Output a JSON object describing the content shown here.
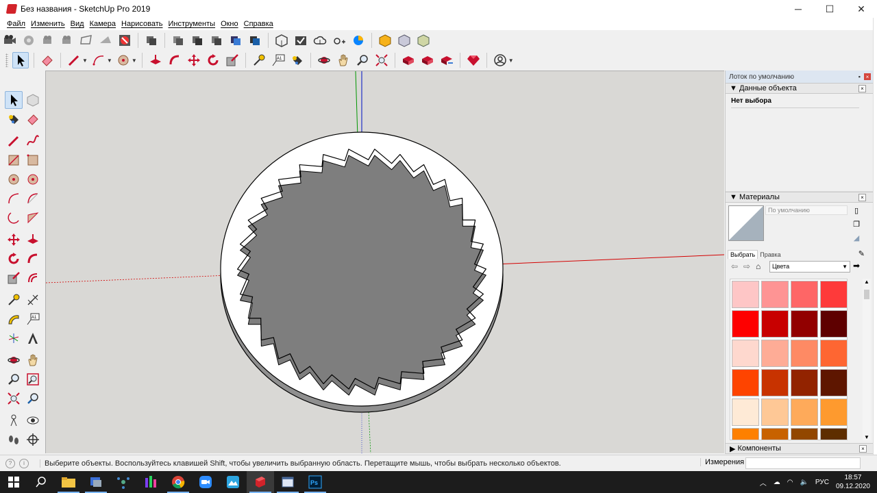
{
  "window": {
    "title": "Без названия - SketchUp Pro 2019"
  },
  "menu": [
    "Файл",
    "Изменить",
    "Вид",
    "Камера",
    "Нарисовать",
    "Инструменты",
    "Окно",
    "Справка"
  ],
  "tray": {
    "title": "Лоток по умолчанию",
    "entity_info": {
      "header": "Данные объекта",
      "status": "Нет выбора"
    },
    "materials": {
      "header": "Материалы",
      "name": "По умолчанию",
      "tab_select": "Выбрать",
      "tab_edit": "Правка",
      "category": "Цвета",
      "swatches": [
        "#fec6c6",
        "#fe9494",
        "#fe6666",
        "#fe3a3a",
        "#fe0000",
        "#c80000",
        "#920000",
        "#5e0000",
        "#fed8ce",
        "#feac96",
        "#fe8a64",
        "#fe6632",
        "#fe4400",
        "#c83300",
        "#922300",
        "#5e1600",
        "#feead6",
        "#fec896",
        "#feaa5a",
        "#fe9a2e",
        "#fe8000",
        "#c86200",
        "#924700",
        "#5e2e00"
      ]
    },
    "components": {
      "header": "Компоненты"
    }
  },
  "status": {
    "hint": "Выберите объекты. Воспользуйтесь клавишей Shift, чтобы увеличить выбранную область. Перетащите мышь, чтобы выбрать несколько объектов.",
    "measurements_label": "Измерения"
  },
  "taskbar": {
    "lang": "РУС",
    "time": "18:57",
    "date": "09.12.2020"
  },
  "colors": {
    "viewport": "#d9d8d5",
    "axis_red": "#d40000",
    "axis_green": "#009600",
    "axis_blue": "#0000c8"
  }
}
